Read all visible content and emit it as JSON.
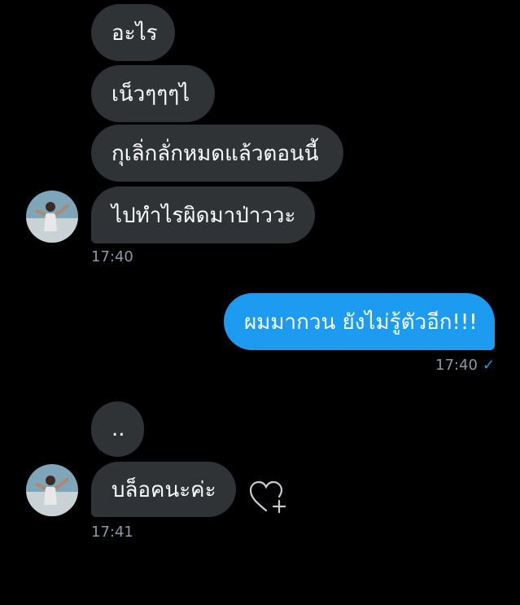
{
  "messages_incoming_group1": [
    {
      "text": "อะไร"
    },
    {
      "text": "เน็วๆๆๆไ"
    },
    {
      "text": "กุเลิ่กลั่กหมดแล้วตอนนี้"
    },
    {
      "text": "ไปทำไรผิดมาป่าววะ"
    }
  ],
  "time_group1": "17:40",
  "message_outgoing": {
    "text": "ผมมากวน ยังไม่รู้ตัวอีก!!!"
  },
  "time_outgoing": "17:40",
  "delivered_icon": "checkmark-icon",
  "messages_incoming_group2": [
    {
      "text": ".."
    },
    {
      "text": "บล็อคนะค่ะ"
    }
  ],
  "time_group2": "17:41",
  "react_icon": "heart-plus-icon",
  "colors": {
    "background": "#000000",
    "incoming_bubble": "#2f3336",
    "outgoing_bubble": "#1d9bf0",
    "timestamp": "#8b98a5"
  }
}
